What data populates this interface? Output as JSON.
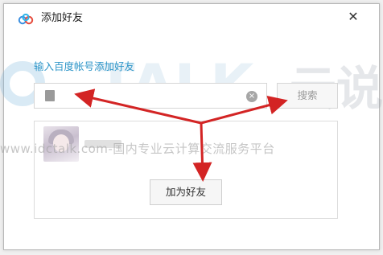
{
  "window": {
    "title": "添加好友",
    "close_glyph": "✕"
  },
  "form": {
    "prompt": "输入百度帐号添加好友",
    "search_value": "",
    "clear_glyph": "×",
    "search_label": "搜索"
  },
  "result": {
    "add_label": "加为好友"
  },
  "watermark": {
    "brand": "TALK",
    "brand_cn": "云说",
    "line": "www.idctalk.com-国内专业云计算交流服务平台"
  },
  "colors": {
    "prompt": "#2d95c8",
    "arrow": "#d32424"
  }
}
